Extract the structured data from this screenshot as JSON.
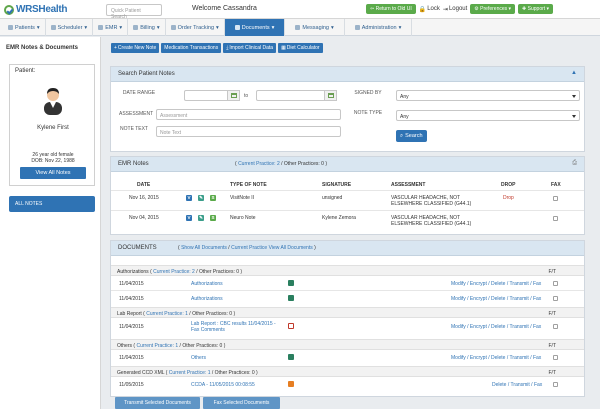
{
  "app": {
    "logo_text": "WRSHealth"
  },
  "topbar": {
    "search_placeholder": "Quick Patient Search",
    "welcome": "Welcome Cassandra",
    "return_btn": "Return to Old UI",
    "lock": "Lock",
    "logout": "Logout",
    "preferences": "Preferences",
    "support": "Support"
  },
  "nav": {
    "items": [
      {
        "label": "Patients"
      },
      {
        "label": "Scheduler"
      },
      {
        "label": "EMR"
      },
      {
        "label": "Billing"
      },
      {
        "label": "Order Tracking"
      },
      {
        "label": "Documents"
      },
      {
        "label": "Messaging"
      },
      {
        "label": "Administration"
      }
    ],
    "active_index": 5
  },
  "left": {
    "title": "EMR Notes & Documents",
    "patient_header": "Patient:",
    "patient_name": "Kylene First",
    "age_sex": "26 year old female",
    "dob": "DOB: Nov 22, 1988",
    "view_all": "View All Notes",
    "all_notes": "ALL NOTES"
  },
  "actions": [
    {
      "label": "Create New Note",
      "icon": "plus-icon"
    },
    {
      "label": "Medication Transactions",
      "icon": ""
    },
    {
      "label": "Import Clinical Data",
      "icon": "download-icon"
    },
    {
      "label": "Diet Calculator",
      "icon": "calculator-icon"
    }
  ],
  "search": {
    "title": "Search Patient Notes",
    "date_range_label": "DATE RANGE",
    "to": "to",
    "assessment_label": "ASSESSMENT",
    "assessment_placeholder": "Assessment",
    "note_text_label": "NOTE TEXT",
    "note_text_placeholder": "Note Text",
    "signed_by_label": "SIGNED BY",
    "signed_by_value": "Any",
    "note_type_label": "NOTE TYPE",
    "note_type_value": "Any",
    "search_btn": "Search"
  },
  "emr_notes": {
    "title": "EMR Notes",
    "current_practice": "Current Practice: 2",
    "other_practices": "Other Practices: 0",
    "headers": [
      "DATE",
      "TYPE OF NOTE",
      "SIGNATURE",
      "ASSESSMENT",
      "DROP",
      "FAX"
    ],
    "rows": [
      {
        "date": "Nov 16, 2015",
        "type": "VisitNote II",
        "signature": "unsigned",
        "assessment": "VASCULAR HEADACHE, NOT ELSEWHERE CLASSIFIED (G44.1)",
        "drop": "Drop",
        "badges": [
          "V",
          "E",
          "S"
        ]
      },
      {
        "date": "Nov 04, 2015",
        "type": "Neuro Note",
        "signature": "Kylene Zemora",
        "assessment": "VASCULAR HEADACHE, NOT ELSEWHERE CLASSIFIED (G44.1)",
        "drop": "",
        "badges": [
          "V",
          "E",
          "S"
        ]
      }
    ]
  },
  "documents": {
    "title": "DOCUMENTS",
    "show_all": "Show All Documents",
    "current_practice": "Current Practice",
    "view_all": "View All Documents",
    "groups": [
      {
        "label": "Authorizations",
        "current": "Current Practice: 2",
        "other": "Other Practices: 0",
        "ft": "F/T",
        "rows": [
          {
            "date": "11/04/2015",
            "name": "Authorizations",
            "icon": "image",
            "actions": "Modify / Encrypt / Delete / Transmit / Fax"
          },
          {
            "date": "11/04/2015",
            "name": "Authorizations",
            "icon": "image",
            "actions": "Modify / Encrypt / Delete / Transmit / Fax"
          }
        ]
      },
      {
        "label": "Lab Report",
        "current": "Current Practice: 1",
        "other": "Other Practices: 0",
        "ft": "F/T",
        "rows": [
          {
            "date": "11/04/2015",
            "name": "Lab Report : CBC results 11/04/2015 - Fax Comments",
            "icon": "pdf",
            "actions": "Modify / Encrypt / Delete / Transmit / Fax"
          }
        ]
      },
      {
        "label": "Others",
        "current": "Current Practice: 1",
        "other": "Other Practices: 0",
        "ft": "F/T",
        "rows": [
          {
            "date": "11/04/2015",
            "name": "Others",
            "icon": "image",
            "actions": "Modify / Encrypt / Delete / Transmit / Fax"
          }
        ]
      },
      {
        "label": "Generated CCD XML",
        "current": "Current Practice: 1",
        "other": "Other Practices: 0",
        "ft": "F/T",
        "rows": [
          {
            "date": "11/05/2015",
            "name": "CCDA - 11/05/2015 00:08:55",
            "icon": "xml",
            "actions": "Delete / Transmit / Fax"
          }
        ]
      }
    ],
    "transmit_btn": "Transmit Selected Documents",
    "fax_btn": "Fax Selected Documents"
  },
  "colors": {
    "primary": "#2f73b4",
    "green": "#5aaa4a",
    "drop_red": "#c0392b"
  }
}
